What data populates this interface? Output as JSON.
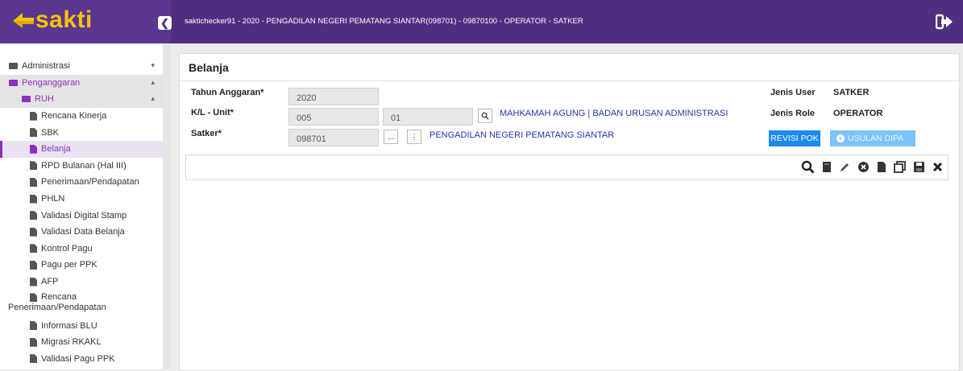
{
  "app": {
    "logo_text": "sakti",
    "title": "saktichecker91 - 2020 - PENGADILAN NEGERI PEMATANG SIANTAR(098701) - 09870100 - OPERATOR - SATKER"
  },
  "colors": {
    "topbar": "#4f2d7f",
    "logo": "#f5c400",
    "accent": "#8e2fbf",
    "primary_button": "#1a8af0",
    "disabled_button": "#7cc3f7"
  },
  "sidebar": {
    "items": [
      {
        "label": "Administrasi",
        "icon": "folder-icon"
      },
      {
        "label": "Penganggaran",
        "icon": "folder-icon"
      },
      {
        "label": "RUH",
        "icon": "folder-icon"
      },
      {
        "label": "Rencana Kinerja",
        "icon": "document-icon"
      },
      {
        "label": "SBK",
        "icon": "document-icon"
      },
      {
        "label": "Belanja",
        "icon": "document-icon"
      },
      {
        "label": "RPD Bulanan (Hal III)",
        "icon": "document-icon"
      },
      {
        "label": "Penerimaan/Pendapatan",
        "icon": "document-icon"
      },
      {
        "label": "PHLN",
        "icon": "document-icon"
      },
      {
        "label": "Validasi Digital Stamp",
        "icon": "document-icon"
      },
      {
        "label": "Validasi Data Belanja",
        "icon": "document-icon"
      },
      {
        "label": "Kontrol Pagu",
        "icon": "document-icon"
      },
      {
        "label": "Pagu per PPK",
        "icon": "document-icon"
      },
      {
        "label": "AFP",
        "icon": "document-icon"
      },
      {
        "label_line1": "Rencana",
        "label_line2": "Penerimaan/Pendapatan",
        "icon": "document-icon"
      },
      {
        "label": "Informasi BLU",
        "icon": "document-icon"
      },
      {
        "label": "Migrasi RKAKL",
        "icon": "document-icon"
      },
      {
        "label": "Validasi Pagu PPK",
        "icon": "document-icon"
      }
    ]
  },
  "main": {
    "title": "Belanja",
    "form": {
      "tahun_label": "Tahun Anggaran*",
      "tahun_value": "2020",
      "kl_label": "K/L - Unit*",
      "kl_value": "005",
      "unit_value": "01",
      "kl_link": "MAHKAMAH AGUNG | BADAN URUSAN ADMINISTRASI",
      "satker_label": "Satker*",
      "satker_value": "098701",
      "satker_btn1": "...",
      "satker_btn2": "⋮",
      "satker_link": "PENGADILAN NEGERI PEMATANG SIANTAR"
    },
    "info": {
      "jenis_user_label": "Jenis User",
      "jenis_user_value": "SATKER",
      "jenis_role_label": "Jenis Role",
      "jenis_role_value": "OPERATOR"
    },
    "buttons": {
      "revisi_pok": "REVISI POK",
      "usulan_dipa": "USULAN DIPA"
    },
    "toolbar_icons": [
      "search-icon",
      "bookmark-icon",
      "edit-icon",
      "delete-circle-icon",
      "document-icon",
      "copy-icon",
      "save-icon",
      "close-icon"
    ]
  }
}
